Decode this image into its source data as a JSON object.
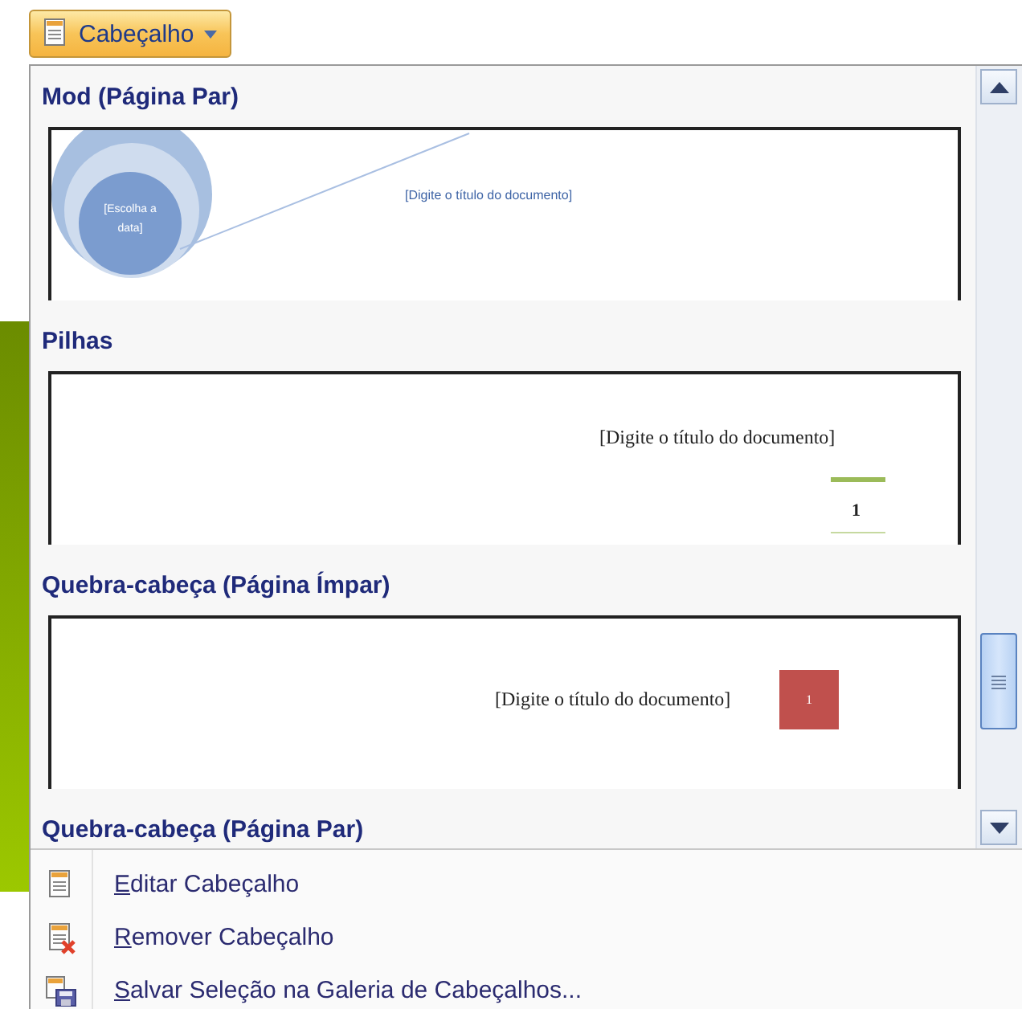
{
  "button": {
    "label": "Cabeçalho"
  },
  "gallery": [
    {
      "title": "Mod (Página Par)",
      "preview": {
        "kind": "circles",
        "title_text": "[Digite o título do documento]",
        "date_text": "[Escolha a data]"
      }
    },
    {
      "title": "Pilhas",
      "preview": {
        "kind": "stacks",
        "title_text": "[Digite o título do documento]",
        "page_number": "1"
      }
    },
    {
      "title": "Quebra-cabeça (Página Ímpar)",
      "preview": {
        "kind": "puzzle",
        "title_text": "[Digite o título do documento]",
        "page_number": "1"
      }
    },
    {
      "title": "Quebra-cabeça (Página Par)"
    }
  ],
  "menu": [
    {
      "kind": "edit",
      "mnemonic": "E",
      "rest": "ditar Cabeçalho"
    },
    {
      "kind": "remove",
      "mnemonic": "R",
      "rest": "emover Cabeçalho"
    },
    {
      "kind": "save",
      "mnemonic": "S",
      "rest": "alvar Seleção na Galeria de Cabeçalhos..."
    }
  ]
}
